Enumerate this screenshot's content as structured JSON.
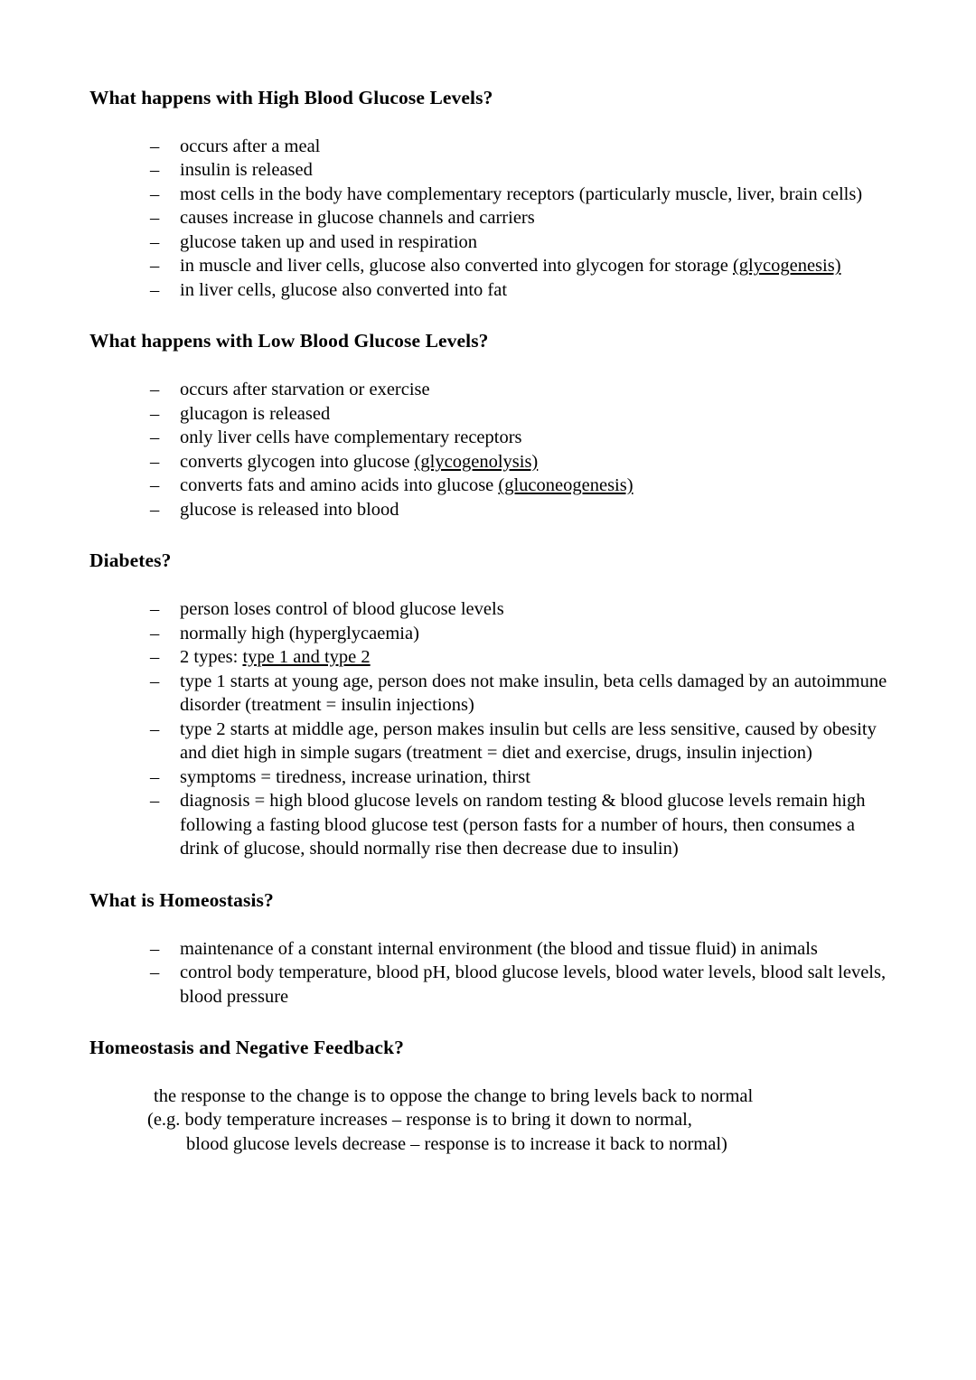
{
  "document": {
    "bullet_marker": "–",
    "sections": [
      {
        "id": "high-blood-glucose",
        "heading": "What happens with High Blood Glucose Levels?",
        "items": [
          {
            "text": "occurs after a meal"
          },
          {
            "text": "insulin is released"
          },
          {
            "text": "most cells in the body have complementary receptors (particularly muscle, liver, brain cells)"
          },
          {
            "text": "causes increase in glucose channels and carriers"
          },
          {
            "text": "glucose taken up and used in respiration"
          },
          {
            "pre": "in muscle and liver cells, glucose also converted into glycogen for storage ",
            "underline": "(glycogenesis)",
            "post": ""
          },
          {
            "text": "in liver cells, glucose also converted into fat"
          }
        ]
      },
      {
        "id": "low-blood-glucose",
        "heading": "What happens with Low Blood Glucose Levels?",
        "items": [
          {
            "text": "occurs after starvation or exercise"
          },
          {
            "text": "glucagon is released"
          },
          {
            "text": "only liver cells have complementary receptors"
          },
          {
            "pre": "converts glycogen into glucose ",
            "underline": "(glycogenolysis)",
            "post": ""
          },
          {
            "pre": "converts fats and amino acids into glucose ",
            "underline": "(gluconeogenesis)",
            "post": ""
          },
          {
            "text": "glucose is released into blood"
          }
        ]
      },
      {
        "id": "diabetes",
        "heading": "Diabetes?",
        "items": [
          {
            "text": "person loses control of blood glucose levels"
          },
          {
            "text": "normally high (hyperglycaemia)"
          },
          {
            "pre": "2 types: ",
            "underline": "type 1 and type 2",
            "post": ""
          },
          {
            "text": "type 1 starts at young age, person does not make insulin, beta cells damaged by an autoimmune disorder (treatment = insulin injections)"
          },
          {
            "text": "type 2 starts at middle age, person makes insulin but cells are less sensitive, caused by obesity and diet high in simple sugars (treatment = diet and exercise, drugs, insulin injection)"
          },
          {
            "text": "symptoms = tiredness, increase urination, thirst"
          },
          {
            "text": "diagnosis = high blood glucose levels on random testing & blood glucose levels remain high following a fasting blood glucose test (person fasts for a number of hours, then consumes a drink of glucose, should normally rise then decrease due to insulin)"
          }
        ]
      },
      {
        "id": "what-is-homeostasis",
        "heading": "What is Homeostasis?",
        "items": [
          {
            "text": "maintenance of a constant internal environment (the blood and tissue fluid) in animals"
          },
          {
            "text": "control body temperature, blood pH, blood glucose levels, blood water levels, blood salt levels, blood pressure"
          }
        ]
      },
      {
        "id": "homeostasis-negative-feedback",
        "heading": "Homeostasis and Negative Feedback?",
        "paragraph": {
          "line1": "the response to the change is to oppose the change to bring levels back to normal",
          "line2": "(e.g. body temperature increases – response is to bring it down to normal,",
          "line3": "blood glucose levels decrease – response is to increase it back to normal)"
        }
      }
    ]
  }
}
